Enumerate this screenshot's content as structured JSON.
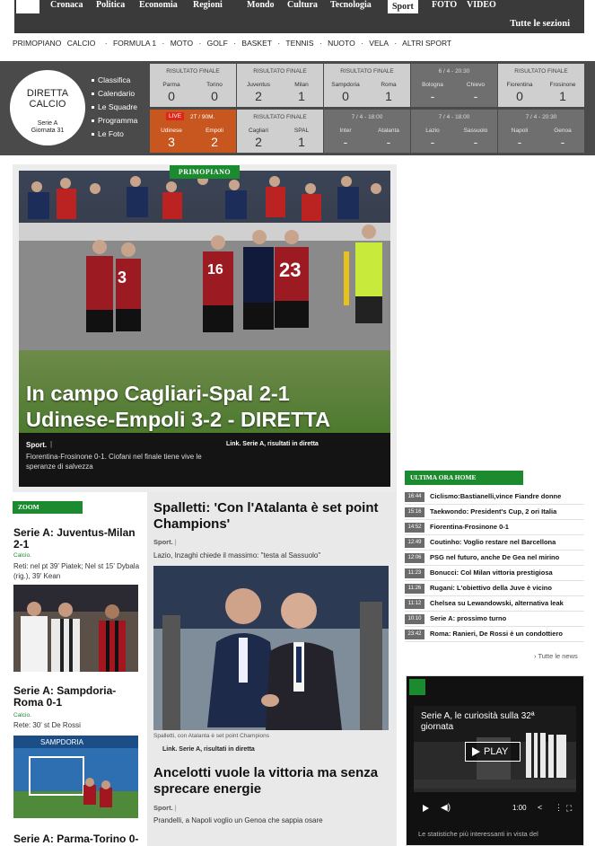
{
  "topnav": {
    "items": [
      "Cronaca",
      "Politica",
      "Economia",
      "Regioni",
      "Mondo",
      "Cultura",
      "Tecnologia",
      "Sport",
      "FOTO",
      "VIDEO"
    ],
    "tutte_label": "Tutte le sezioni"
  },
  "subnav": {
    "items": [
      "PRIMOPIANO",
      "CALCIO",
      "FORMULA 1",
      "MOTO",
      "GOLF",
      "BASKET",
      "TENNIS",
      "NUOTO",
      "VELA",
      "ALTRI SPORT"
    ]
  },
  "diretta": {
    "title_line1": "DIRETTA",
    "title_line2": "CALCIO",
    "league": "Serie A",
    "giornata": "Giornata 31"
  },
  "diretta_menu": [
    "Classifica",
    "Calendario",
    "Le Squadre",
    "Programma",
    "Le Foto"
  ],
  "matches": [
    {
      "status": "final",
      "header": "RISULTATO FINALE",
      "home": "Parma",
      "away": "Torino",
      "home_score": "0",
      "away_score": "0"
    },
    {
      "status": "final",
      "header": "RISULTATO FINALE",
      "home": "Juventus",
      "away": "Milan",
      "home_score": "2",
      "away_score": "1"
    },
    {
      "status": "final",
      "header": "RISULTATO FINALE",
      "home": "Sampdoria",
      "away": "Roma",
      "home_score": "0",
      "away_score": "1"
    },
    {
      "status": "upcoming",
      "header": "6 / 4 - 20:30",
      "home": "Bologna",
      "away": "Chievo",
      "home_score": "-",
      "away_score": "-"
    },
    {
      "status": "final",
      "header": "RISULTATO FINALE",
      "home": "Fiorentina",
      "away": "Frosinone",
      "home_score": "0",
      "away_score": "1"
    },
    {
      "status": "live",
      "live_label": "LIVE",
      "header": "2T / 90M.",
      "home": "Udinese",
      "away": "Empoli",
      "home_score": "3",
      "away_score": "2"
    },
    {
      "status": "final",
      "header": "RISULTATO FINALE",
      "home": "Cagliari",
      "away": "SPAL",
      "home_score": "2",
      "away_score": "1"
    },
    {
      "status": "upcoming",
      "header": "7 / 4 - 18:00",
      "home": "Inter",
      "away": "Atalanta",
      "home_score": "-",
      "away_score": "-"
    },
    {
      "status": "upcoming",
      "header": "7 / 4 - 18:00",
      "home": "Lazio",
      "away": "Sassuolo",
      "home_score": "-",
      "away_score": "-"
    },
    {
      "status": "upcoming",
      "header": "7 / 4 - 20:30",
      "home": "Napoli",
      "away": "Genoa",
      "home_score": "-",
      "away_score": "-"
    }
  ],
  "feature": {
    "badge": "PRIMOPIANO",
    "title_line1": "In campo Cagliari-Spal 2-1",
    "title_line2": "Udinese-Empoli 3-2 - DIRETTA",
    "sport_label": "Sport.",
    "subtitle": "Fiorentina-Frosinone 0-1. Ciofani nel finale tiene vive le speranze di salvezza",
    "link": "Link. Serie A, risultati in diretta",
    "jersey_numbers": [
      "3",
      "16",
      "23"
    ]
  },
  "zoom": {
    "badge": "ZOOM",
    "articles": [
      {
        "title": "Serie A: Juventus-Milan 2-1",
        "category": "Calcio.",
        "body": "Reti: nel pt 39' Piatek; Nel st 15' Dybala (rig.), 39' Kean"
      },
      {
        "title": "Serie A: Sampdoria-Roma 0-1",
        "category": "Calcio.",
        "body": "Rete: 30' st De Rossi"
      },
      {
        "title": "Serie A: Parma-Torino 0-"
      }
    ],
    "banner_text": "SAMPDORIA"
  },
  "center": {
    "article1": {
      "title": "Spalletti: 'Con l'Atalanta è set point Champions'",
      "sport_label": "Sport.",
      "subtitle": "Lazio, Inzaghi chiede il massimo: \"testa al Sassuolo\"",
      "caption": "Spalletti, con Atalanta è set point Champions",
      "link": "Link. Serie A, risultati in diretta"
    },
    "article2": {
      "title": "Ancelotti vuole la vittoria ma senza sprecare energie",
      "sport_label": "Sport.",
      "subtitle": "Prandelli, a Napoli voglio un Genoa che sappia osare"
    }
  },
  "ultima_ora": {
    "badge": "ULTIMA ORA HOME",
    "items": [
      {
        "time": "16:44",
        "text": "Ciclismo:Bastianelli,vince Fiandre donne"
      },
      {
        "time": "15:16",
        "text": "Taekwondo: President's Cup, 2 ori Italia"
      },
      {
        "time": "14:52",
        "text": "Fiorentina-Frosinone 0-1"
      },
      {
        "time": "12:49",
        "text": "Coutinho: Voglio restare nel Barcellona"
      },
      {
        "time": "12:06",
        "text": "PSG nel futuro, anche De Gea nel mirino"
      },
      {
        "time": "11:23",
        "text": "Bonucci: Col Milan vittoria prestigiosa"
      },
      {
        "time": "11:26",
        "text": "Rugani: L'obiettivo della Juve è vicino"
      },
      {
        "time": "11:12",
        "text": "Chelsea su Lewandowski, alternativa leak"
      },
      {
        "time": "10:10",
        "text": "Serie A: prossimo turno"
      },
      {
        "time": "23:42",
        "text": "Roma: Ranieri, De Rossi è un condottiero"
      }
    ],
    "all_label": "› Tutte le news"
  },
  "video": {
    "title": "Serie A, le curiosità sulla 32ª giornata",
    "play_label": "PLAY",
    "time": "1:00",
    "description": "Le statistiche più interessanti in vista del"
  }
}
